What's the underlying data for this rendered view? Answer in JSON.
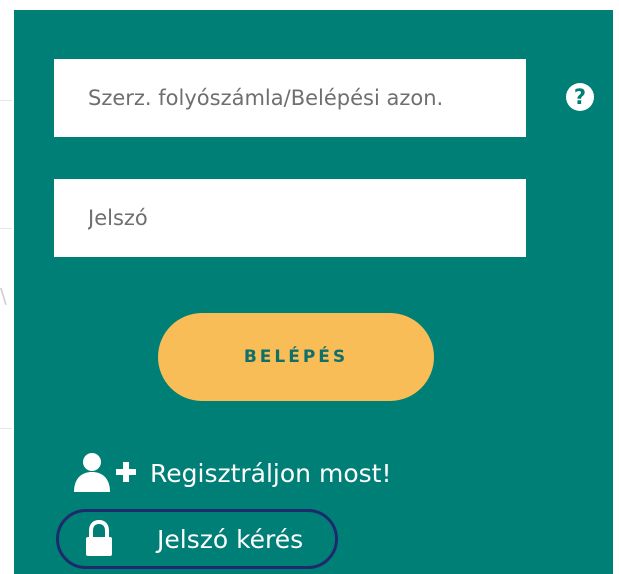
{
  "login": {
    "username_placeholder": "Szerz. folyószámla/Belépési azon.",
    "username_value": "",
    "password_placeholder": "Jelszó",
    "password_value": "",
    "help_glyph": "?",
    "submit_label": "BELÉPÉS",
    "register_label": "Regisztráljon most!",
    "password_request_label": "Jelszó kérés"
  },
  "icons": {
    "help": "question-circle-icon",
    "register": "add-user-icon",
    "password_request": "lock-icon"
  },
  "colors": {
    "panel": "#007f77",
    "button": "#f8bd56",
    "button_text": "#0f6f6a",
    "highlight_ring": "#1d2a6b"
  }
}
